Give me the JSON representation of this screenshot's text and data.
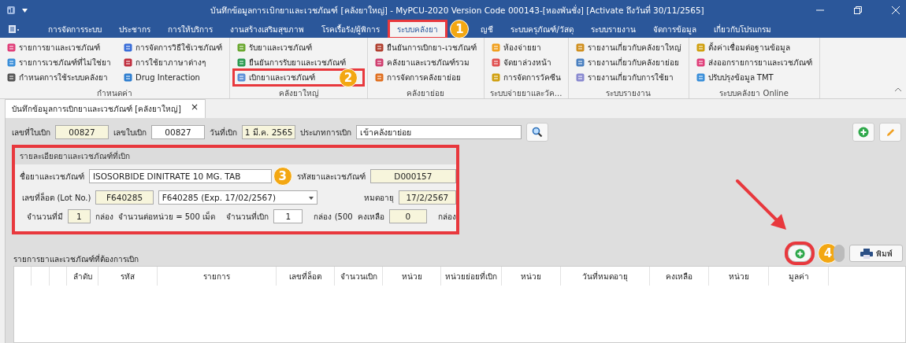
{
  "window": {
    "title": "บันทึกข้อมูลการเบิกยาและเวชภัณฑ์ [คลังยาใหญ่] - MyPCU-2020 Version Code 000143-[หองพันชั่ง] [Activate ถึงวันที่ 30/11/2565]"
  },
  "menu": [
    {
      "label": "การจัดการระบบ",
      "selected": false
    },
    {
      "label": "ประชากร",
      "selected": false
    },
    {
      "label": "การให้บริการ",
      "selected": false
    },
    {
      "label": "งานสร้างเสริมสุขภาพ",
      "selected": false
    },
    {
      "label": "โรคเรื้อรัง/ผู้พิการ",
      "selected": false
    },
    {
      "label": "ระบบคลังยา",
      "selected": true,
      "step": "1"
    },
    {
      "label": "ญชี",
      "selected": false
    },
    {
      "label": "ระบบครุภัณฑ์/วัสดุ",
      "selected": false
    },
    {
      "label": "ระบบรายงาน",
      "selected": false
    },
    {
      "label": "จัดการข้อมูล",
      "selected": false
    },
    {
      "label": "เกี่ยวกับโปรแกรม",
      "selected": false
    }
  ],
  "ribbon": [
    {
      "label": "กำหนดค่า",
      "columns": [
        [
          {
            "label": "รายการยาและเวชภัณฑ์"
          },
          {
            "label": "รายการเวชภัณฑ์ที่ไม่ใช่ยา"
          },
          {
            "label": "กำหนดการใช้ระบบคลังยา"
          }
        ],
        [
          {
            "label": "การจัดการวิธีใช้เวชภัณฑ์"
          },
          {
            "label": "การใช้ยาภาษาต่างๆ"
          },
          {
            "label": "Drug Interaction"
          }
        ]
      ]
    },
    {
      "label": "คลังยาใหญ่",
      "columns": [
        [
          {
            "label": "รับยาและเวชภัณฑ์"
          },
          {
            "label": "ยืนยันการรับยาและเวชภัณฑ์"
          },
          {
            "label": "เบิกยาและเวชภัณฑ์",
            "step": "2"
          }
        ]
      ]
    },
    {
      "label": "คลังยาย่อย",
      "columns": [
        [
          {
            "label": "ยืนยันการเบิกยา-เวชภัณฑ์"
          },
          {
            "label": "คลังยาและเวชภัณฑ์รวม"
          },
          {
            "label": "การจัดการคลังยาย่อย"
          }
        ]
      ]
    },
    {
      "label": "ระบบจ่ายยาและวัค...",
      "columns": [
        [
          {
            "label": "ห้องจ่ายยา"
          },
          {
            "label": "จัดยาล่วงหน้า"
          },
          {
            "label": "การจัดการวัคซีน"
          }
        ]
      ]
    },
    {
      "label": "ระบบรายงาน",
      "columns": [
        [
          {
            "label": "รายงานเกี่ยวกับคลังยาใหญ่"
          },
          {
            "label": "รายงานเกี่ยวกับคลังยาย่อย"
          },
          {
            "label": "รายงานเกี่ยวกับการใช้ยา"
          }
        ]
      ]
    },
    {
      "label": "ระบบคลังยา Online",
      "columns": [
        [
          {
            "label": "ตั้งค่าเชื่อมต่อฐานข้อมูล"
          },
          {
            "label": "ส่งออกรายการยาและเวชภัณฑ์"
          },
          {
            "label": "ปรับปรุงข้อมูล TMT"
          }
        ]
      ]
    }
  ],
  "document_tab": {
    "label": "บันทึกข้อมูลการเบิกยาและเวชภัณฑ์ [คลังยาใหญ่]",
    "close": "×"
  },
  "header_fields": [
    {
      "label": "เลขที่ใบเบิก",
      "value": "00827",
      "readonly": true
    },
    {
      "label": "เลขใบเบิก",
      "value": "00827",
      "readonly": false
    },
    {
      "label": "วันที่เบิก",
      "value": "1 มี.ค. 2565",
      "readonly": true
    },
    {
      "label": "ประเภทการเบิก",
      "value": "เข้าคลังยาย่อย",
      "readonly": false
    }
  ],
  "details": {
    "title": "รายละเอียดยาและเวชภัณฑ์ที่เบิก",
    "step": "3",
    "drug_name": {
      "label": "ชื่อยาและเวชภัณฑ์",
      "value": "ISOSORBIDE DINITRATE 10 MG. TAB",
      "readonly": false
    },
    "drug_code": {
      "label": "รหัสยาและเวชภัณฑ์",
      "value": "D000157",
      "readonly": true
    },
    "lot": {
      "label": "เลขที่ล็อต (Lot No.)",
      "value": "F640285",
      "readonly": true
    },
    "lot_select": {
      "value": "F640285 (Exp. 17/02/2567)"
    },
    "expiry": {
      "label": "หมดอายุ",
      "value": "17/2/2567",
      "readonly": true
    },
    "stock": {
      "label": "จำนวนที่มี",
      "value": "1",
      "readonly": true,
      "unit": "กล่อง"
    },
    "per_unit": "จำนวนต่อหน่วย = 500 เม็ด",
    "request": {
      "label": "จำนวนที่เบิก",
      "value": "1",
      "readonly": false,
      "unit": "กล่อง (500"
    },
    "remaining": {
      "label": "คงเหลือ",
      "value": "0",
      "readonly": true,
      "unit": "กล่อง"
    }
  },
  "table": {
    "title": "รายการยาและเวชภัณฑ์ที่ต้องการเบิก",
    "buttons": [
      {
        "kind": "add",
        "step": "4"
      },
      {
        "kind": "other"
      },
      {
        "kind": "print",
        "label": "พิมพ์"
      }
    ],
    "columns": [
      {
        "label": "ลำดับ"
      },
      {
        "label": "รหัส"
      },
      {
        "label": "รายการ"
      },
      {
        "label": "เลขที่ล็อต"
      },
      {
        "label": "จำนวนเบิก"
      },
      {
        "label": "หน่วย"
      },
      {
        "label": "หน่วยย่อยที่เบิก"
      },
      {
        "label": "หน่วย"
      },
      {
        "label": "วันที่หมดอายุ"
      },
      {
        "label": "คงเหลือ"
      },
      {
        "label": "หน่วย"
      },
      {
        "label": "มูลค่า"
      }
    ]
  }
}
